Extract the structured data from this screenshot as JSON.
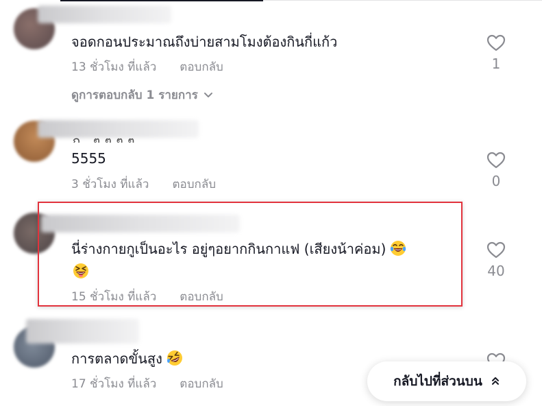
{
  "comments": [
    {
      "text": "จอดกอนประมาณถึงบ่ายสามโมงต้องกินกี่แก้ว",
      "time": "13 ชั่วโมง ที่แล้ว",
      "reply": "ตอบกลับ",
      "likes": "1",
      "view_replies": "ดูการตอบกลับ 1 รายการ"
    },
    {
      "text": "5555",
      "time": "3 ชั่วโมง ที่แล้ว",
      "reply": "ตอบกลับ",
      "likes": "0"
    },
    {
      "text": "นี่ร่างกายกูเป็นอะไร อยู่ๆอยากกินกาแฟ (เสียงน้าค่อม)",
      "time": "15 ชั่วโมง ที่แล้ว",
      "reply": "ตอบกลับ",
      "likes": "40"
    },
    {
      "text": "การตลาดขั้นสูง",
      "time": "17 ชั่วโมง ที่แล้ว",
      "reply": "ตอบกลับ"
    }
  ],
  "back_to_top": {
    "label": "กลับไปที่ส่วนบน"
  },
  "colors": {
    "text": "#161823",
    "muted": "#8a8b91",
    "highlight_border": "#e2333d"
  },
  "icons": {
    "like": "heart-outline-icon",
    "expand": "chevron-down-icon",
    "back_to_top": "double-chevron-up-icon",
    "emoji_laugh": "tears-of-joy-emoji",
    "emoji_squint": "squinting-laugh-emoji",
    "emoji_rofl": "rolling-laugh-emoji"
  }
}
